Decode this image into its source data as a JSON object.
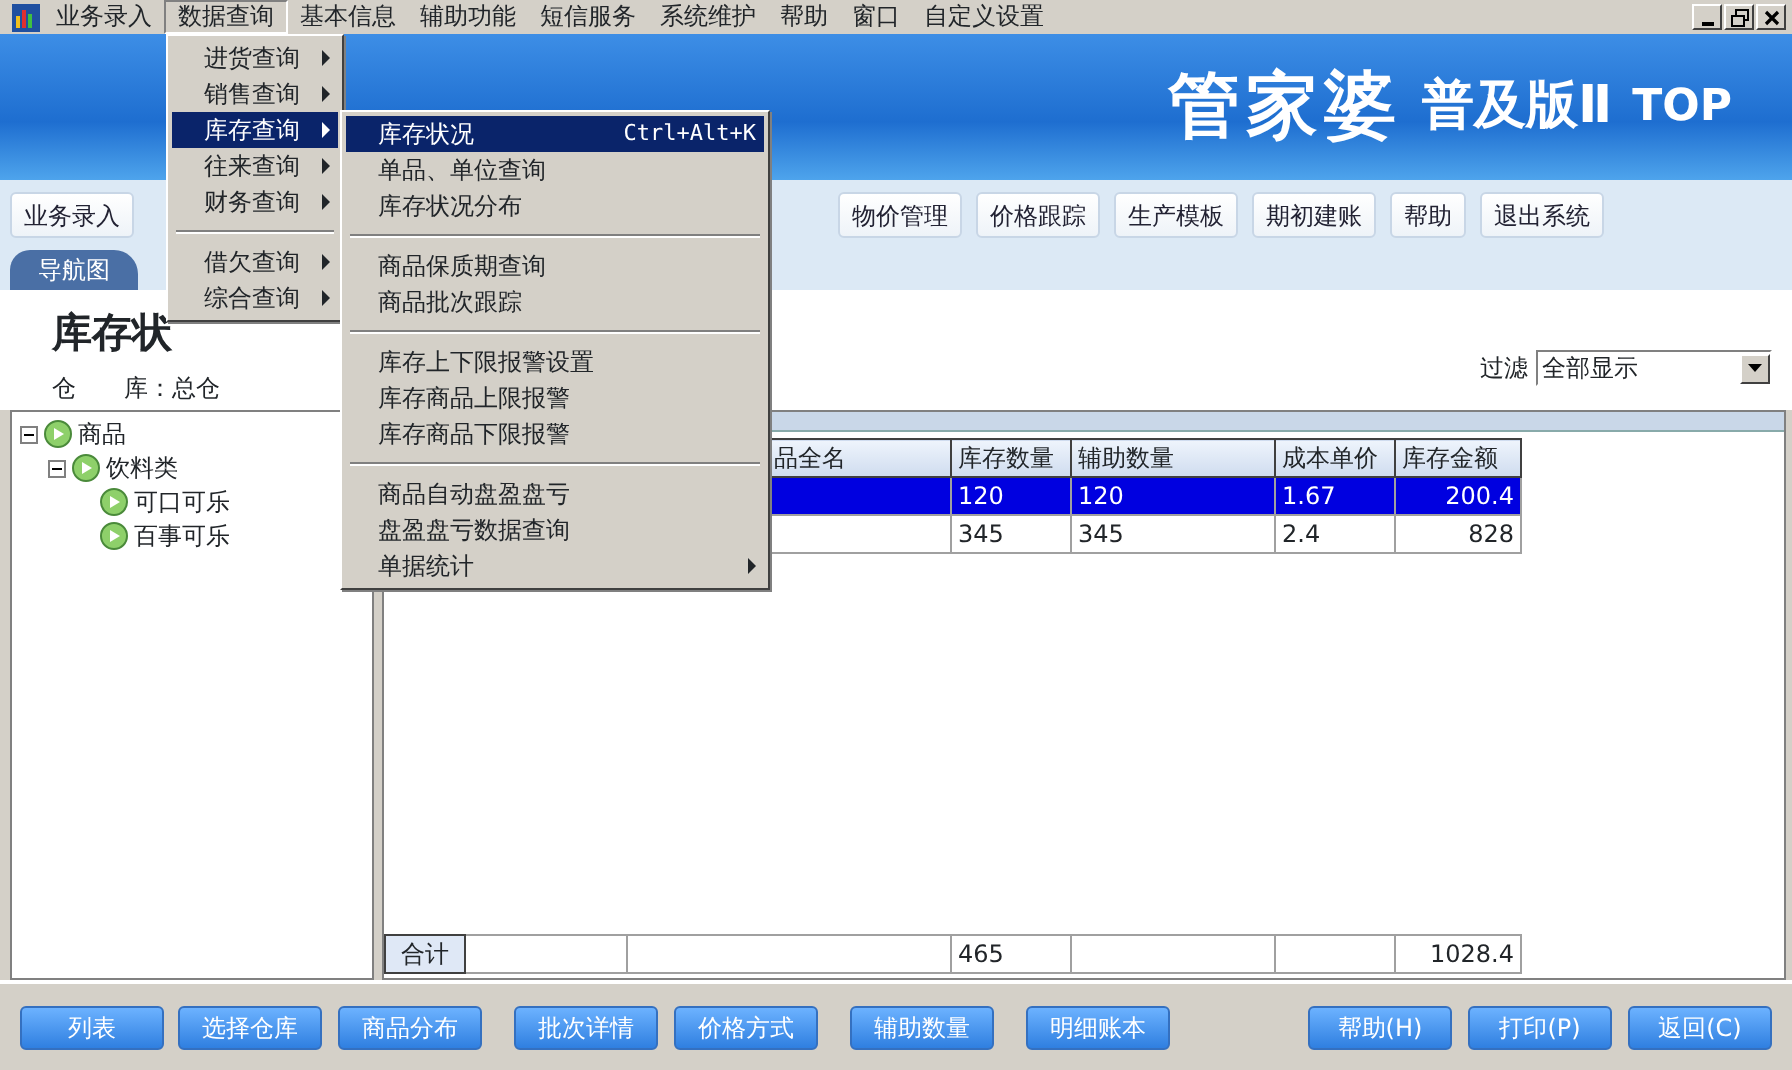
{
  "menubar": [
    {
      "label": "业务录入",
      "selected": false
    },
    {
      "label": "数据查询",
      "selected": true
    },
    {
      "label": "基本信息",
      "selected": false
    },
    {
      "label": "辅助功能",
      "selected": false
    },
    {
      "label": "短信服务",
      "selected": false
    },
    {
      "label": "系统维护",
      "selected": false
    },
    {
      "label": "帮助",
      "selected": false
    },
    {
      "label": "窗口",
      "selected": false
    },
    {
      "label": "自定义设置",
      "selected": false
    }
  ],
  "banner": {
    "brand": "管家婆",
    "edition": "普及版Ⅱ",
    "suffix": "TOP"
  },
  "toolbar_left": [
    "业务录入"
  ],
  "toolbar_right": [
    "物价管理",
    "价格跟踪",
    "生产模板",
    "期初建账",
    "帮助",
    "退出系统"
  ],
  "nav_tab": "导航图",
  "report": {
    "title": "库存状",
    "warehouse_label": "仓　　库：",
    "warehouse": "总仓"
  },
  "filter": {
    "label": "过滤",
    "value": "全部显示"
  },
  "tree": [
    {
      "label": "商品",
      "expanded": true,
      "children": [
        {
          "label": "饮料类",
          "expanded": true,
          "children": [
            {
              "label": "可口可乐"
            },
            {
              "label": "百事可乐"
            }
          ]
        }
      ]
    }
  ],
  "table": {
    "columns": [
      {},
      {},
      {
        "label": "品全名"
      },
      {
        "label": "库存数量"
      },
      {
        "label": "辅助数量"
      },
      {
        "label": "成本单价"
      },
      {
        "label": "库存金额"
      }
    ],
    "rows": [
      {
        "selected": true,
        "quantity": "120",
        "aux_quantity": "120",
        "unit_cost": "1.67",
        "amount": "200.4"
      },
      {
        "selected": false,
        "quantity": "345",
        "aux_quantity": "345",
        "unit_cost": "2.4",
        "amount": "828"
      }
    ],
    "footer": {
      "label": "合计",
      "quantity": "465",
      "amount": "1028.4"
    }
  },
  "bottom_left": [
    "列表",
    "选择仓库",
    "商品分布",
    "批次详情",
    "价格方式",
    "辅助数量",
    "明细账本"
  ],
  "bottom_right": [
    "帮助(H)",
    "打印(P)",
    "返回(C)"
  ],
  "dropdown": [
    {
      "kind": "item",
      "label": "进货查询",
      "selected": false
    },
    {
      "kind": "item",
      "label": "销售查询",
      "selected": false
    },
    {
      "kind": "item",
      "label": "库存查询",
      "selected": true
    },
    {
      "kind": "item",
      "label": "往来查询",
      "selected": false
    },
    {
      "kind": "item",
      "label": "财务查询",
      "selected": false
    },
    {
      "kind": "separator"
    },
    {
      "kind": "item",
      "label": "借欠查询",
      "selected": false
    },
    {
      "kind": "item",
      "label": "综合查询",
      "selected": false
    }
  ],
  "submenu": [
    {
      "kind": "item",
      "label": "库存状况",
      "shortcut": "Ctrl+Alt+K",
      "selected": true
    },
    {
      "kind": "item",
      "label": "单品、单位查询",
      "selected": false
    },
    {
      "kind": "item",
      "label": "库存状况分布",
      "selected": false
    },
    {
      "kind": "separator"
    },
    {
      "kind": "item",
      "label": "商品保质期查询",
      "selected": false
    },
    {
      "kind": "item",
      "label": "商品批次跟踪",
      "selected": false
    },
    {
      "kind": "separator"
    },
    {
      "kind": "item",
      "label": "库存上下限报警设置",
      "selected": false
    },
    {
      "kind": "item",
      "label": "库存商品上限报警",
      "selected": false
    },
    {
      "kind": "item",
      "label": "库存商品下限报警",
      "selected": false
    },
    {
      "kind": "separator"
    },
    {
      "kind": "item",
      "label": "商品自动盘盈盘亏",
      "selected": false
    },
    {
      "kind": "item",
      "label": "盘盈盘亏数据查询",
      "selected": false
    },
    {
      "kind": "submenu",
      "label": "单据统计",
      "selected": false
    }
  ]
}
